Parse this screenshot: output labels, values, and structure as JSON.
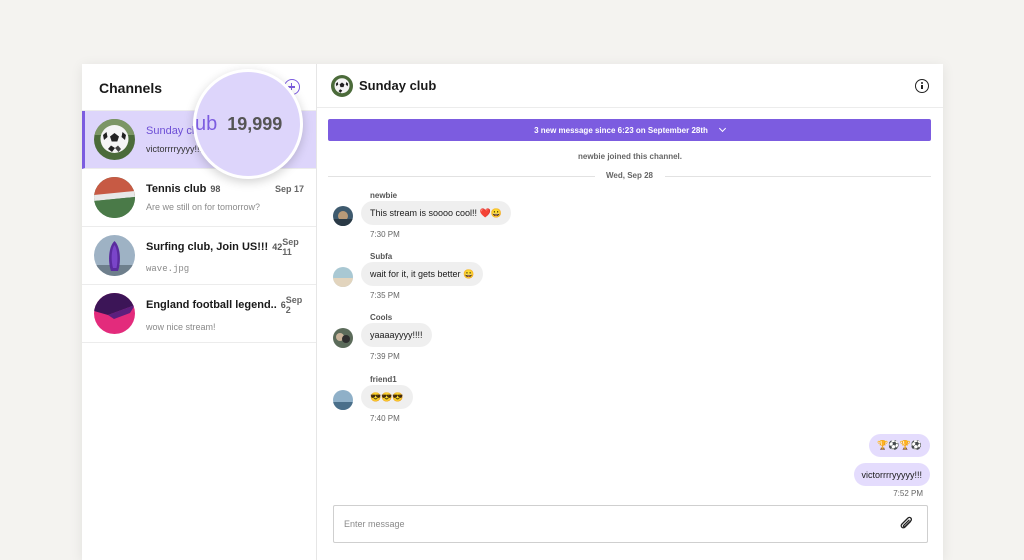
{
  "sidebar": {
    "title": "Channels",
    "channels": [
      {
        "name": "Sunday club",
        "count": "",
        "date": "",
        "preview": "victorrrryyyy!!!"
      },
      {
        "name": "Tennis club",
        "count": "98",
        "date": "Sep 17",
        "preview": "Are we still on for tomorrow?"
      },
      {
        "name": "Surfing club, Join US!!!",
        "count": "42",
        "date": "Sep 11",
        "preview": "wave.jpg"
      },
      {
        "name": "England football legend..",
        "count": "6",
        "date": "Sep 2",
        "preview": "wow nice stream!"
      }
    ],
    "magnifier": {
      "prefix": "ub",
      "value": "19,999"
    }
  },
  "main": {
    "title": "Sunday club",
    "banner": "3 new message since 6:23 on September 28th",
    "system_message": "newbie joined this channel.",
    "date_divider": "Wed, Sep 28",
    "messages": [
      {
        "author": "newbie",
        "text": "This stream is soooo cool!! ❤️😀",
        "time": "7:30 PM"
      },
      {
        "author": "Subfa",
        "text": "wait for it, it gets better 😀",
        "time": "7:35 PM"
      },
      {
        "author": "Cools",
        "text": "yaaaayyyy!!!!",
        "time": "7:39 PM"
      },
      {
        "author": "friend1",
        "text": "😎😎😎",
        "time": "7:40 PM"
      }
    ],
    "own_messages": [
      {
        "text": "🏆⚽🏆⚽"
      },
      {
        "text": "victorrrryyyyy!!!"
      }
    ],
    "own_time": "7:52 PM",
    "composer": {
      "placeholder": "Enter message"
    }
  },
  "colors": {
    "accent": "#7c5ce0",
    "active_bg": "#ddd5fb",
    "own_bubble": "#e4dcfd"
  }
}
